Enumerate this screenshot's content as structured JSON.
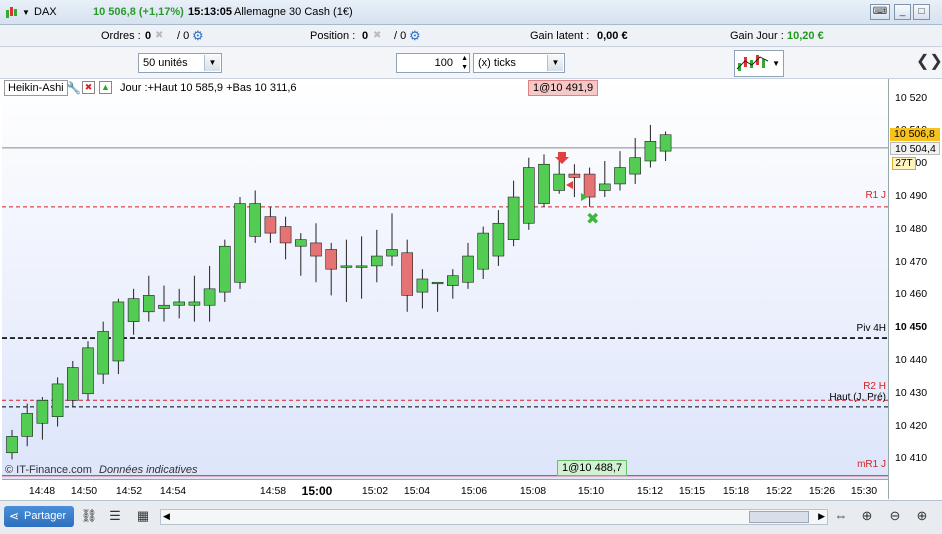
{
  "title": {
    "symbol": "DAX",
    "price": "10 506,8 (+1,17%)",
    "time": "15:13:05",
    "instrument": "Allemagne 30 Cash (1€)"
  },
  "position_bar": {
    "orders_label": "Ordres :",
    "orders_value": "0",
    "orders_total": "/ 0",
    "position_label": "Position :",
    "position_value": "0",
    "position_total": "/ 0",
    "latent_label": "Gain latent :",
    "latent_value": "0,00 €",
    "day_label": "Gain Jour :",
    "day_value": "10,20 €"
  },
  "toolbar": {
    "units": "50 unités",
    "quantity": "100",
    "ticks": "(x) ticks"
  },
  "chart_header": {
    "indicator": "Heikin-Ashi",
    "range": "Jour :+Haut 10 585,9 +Bas 10 311,6",
    "order_top": "1@10 491,9",
    "order_bottom": "1@10 488,7",
    "watermark": "© IT-Finance.com",
    "watermark_note": "Données indicatives"
  },
  "levels": {
    "r1j": "R1 J",
    "piv4h": "Piv 4H",
    "r2h": "R2 H",
    "haut": "Haut (J, Pré)",
    "mr1j": "mR1 J"
  },
  "y_axis": {
    "labels": [
      "10 520",
      "10 510",
      "10 500",
      "10 490",
      "10 480",
      "10 470",
      "10 460",
      "10 450",
      "10 440",
      "10 430",
      "10 420",
      "10 410"
    ],
    "price_box_1": "10 506,8",
    "price_box_2": "10 504,4",
    "count_box": "27T"
  },
  "x_axis": {
    "labels": [
      "14:48",
      "14:50",
      "14:52",
      "14:54",
      "14:58",
      "15:00",
      "15:02",
      "15:04",
      "15:06",
      "15:08",
      "15:10",
      "15:12",
      "15:15",
      "15:18",
      "15:22",
      "15:26",
      "15:30"
    ]
  },
  "status_bar": {
    "share_label": "Partager"
  },
  "colors": {
    "bull": "#52cc52",
    "bear": "#e57373",
    "red_line": "#d62020",
    "price_box": "#f7c21e"
  },
  "chart_data": {
    "type": "candlestick",
    "ylim": [
      10404,
      10526
    ],
    "yticks": [
      10410,
      10420,
      10430,
      10440,
      10450,
      10460,
      10470,
      10480,
      10490,
      10500,
      10510,
      10520
    ],
    "time_labels": [
      "14:48",
      "14:50",
      "14:52",
      "14:54",
      "14:58",
      "15:00",
      "15:02",
      "15:04",
      "15:06",
      "15:08",
      "15:10",
      "15:12",
      "15:15",
      "15:18",
      "15:22",
      "15:26",
      "15:30"
    ],
    "candles": [
      {
        "o": 10412,
        "h": 10419,
        "l": 10410,
        "c": 10417
      },
      {
        "o": 10417,
        "h": 10427,
        "l": 10414,
        "c": 10424
      },
      {
        "o": 10421,
        "h": 10429,
        "l": 10416,
        "c": 10428
      },
      {
        "o": 10423,
        "h": 10435,
        "l": 10420,
        "c": 10433
      },
      {
        "o": 10428,
        "h": 10440,
        "l": 10426,
        "c": 10438
      },
      {
        "o": 10430,
        "h": 10446,
        "l": 10428,
        "c": 10444
      },
      {
        "o": 10436,
        "h": 10452,
        "l": 10433,
        "c": 10449
      },
      {
        "o": 10440,
        "h": 10459,
        "l": 10436,
        "c": 10458
      },
      {
        "o": 10452,
        "h": 10462,
        "l": 10448,
        "c": 10459
      },
      {
        "o": 10455,
        "h": 10466,
        "l": 10452,
        "c": 10460
      },
      {
        "o": 10456,
        "h": 10463,
        "l": 10452,
        "c": 10457
      },
      {
        "o": 10457,
        "h": 10462,
        "l": 10453,
        "c": 10458
      },
      {
        "o": 10457,
        "h": 10466,
        "l": 10452,
        "c": 10458
      },
      {
        "o": 10457,
        "h": 10469,
        "l": 10452,
        "c": 10462
      },
      {
        "o": 10461,
        "h": 10477,
        "l": 10458,
        "c": 10475
      },
      {
        "o": 10464,
        "h": 10490,
        "l": 10462,
        "c": 10488
      },
      {
        "o": 10478,
        "h": 10492,
        "l": 10476,
        "c": 10488
      },
      {
        "o": 10484,
        "h": 10487,
        "l": 10476,
        "c": 10479
      },
      {
        "o": 10481,
        "h": 10484,
        "l": 10471,
        "c": 10476
      },
      {
        "o": 10475,
        "h": 10479,
        "l": 10466,
        "c": 10477
      },
      {
        "o": 10476,
        "h": 10482,
        "l": 10464,
        "c": 10472
      },
      {
        "o": 10474,
        "h": 10476,
        "l": 10460,
        "c": 10468
      },
      {
        "o": 10469,
        "h": 10477,
        "l": 10458,
        "c": 10469
      },
      {
        "o": 10469,
        "h": 10478,
        "l": 10459,
        "c": 10469
      },
      {
        "o": 10469,
        "h": 10480,
        "l": 10464,
        "c": 10472
      },
      {
        "o": 10472,
        "h": 10485,
        "l": 10469,
        "c": 10474
      },
      {
        "o": 10473,
        "h": 10477,
        "l": 10455,
        "c": 10460
      },
      {
        "o": 10461,
        "h": 10468,
        "l": 10456,
        "c": 10465
      },
      {
        "o": 10464,
        "h": 10464,
        "l": 10455,
        "c": 10464
      },
      {
        "o": 10463,
        "h": 10468,
        "l": 10459,
        "c": 10466
      },
      {
        "o": 10464,
        "h": 10476,
        "l": 10462,
        "c": 10472
      },
      {
        "o": 10468,
        "h": 10481,
        "l": 10465,
        "c": 10479
      },
      {
        "o": 10472,
        "h": 10486,
        "l": 10469,
        "c": 10482
      },
      {
        "o": 10477,
        "h": 10495,
        "l": 10475,
        "c": 10490
      },
      {
        "o": 10482,
        "h": 10502,
        "l": 10480,
        "c": 10499
      },
      {
        "o": 10488,
        "h": 10503,
        "l": 10487,
        "c": 10500
      },
      {
        "o": 10492,
        "h": 10502,
        "l": 10491,
        "c": 10497
      },
      {
        "o": 10497,
        "h": 10500,
        "l": 10490,
        "c": 10496
      },
      {
        "o": 10497,
        "h": 10499,
        "l": 10487,
        "c": 10490
      },
      {
        "o": 10492,
        "h": 10501,
        "l": 10490,
        "c": 10494
      },
      {
        "o": 10494,
        "h": 10504,
        "l": 10492,
        "c": 10499
      },
      {
        "o": 10497,
        "h": 10508,
        "l": 10494,
        "c": 10502
      },
      {
        "o": 10501,
        "h": 10512,
        "l": 10499,
        "c": 10507
      },
      {
        "o": 10504,
        "h": 10510,
        "l": 10501,
        "c": 10509
      }
    ],
    "levels": [
      {
        "name": "R1 J",
        "value": 10487,
        "color": "#d62020",
        "style": "dashed"
      },
      {
        "name": "Piv 4H",
        "value": 10447,
        "color": "#000000",
        "style": "dashed"
      },
      {
        "name": "R2 H",
        "value": 10428,
        "color": "#d62020",
        "style": "dashed"
      },
      {
        "name": "Haut (J, Pré)",
        "value": 10426,
        "color": "#000000",
        "style": "dashed"
      },
      {
        "name": "mR1 J",
        "value": 10405,
        "color": "#d62020",
        "style": "solid"
      },
      {
        "name": "",
        "value": 10505,
        "color": "#888888",
        "style": "solid"
      }
    ],
    "grid": false
  }
}
